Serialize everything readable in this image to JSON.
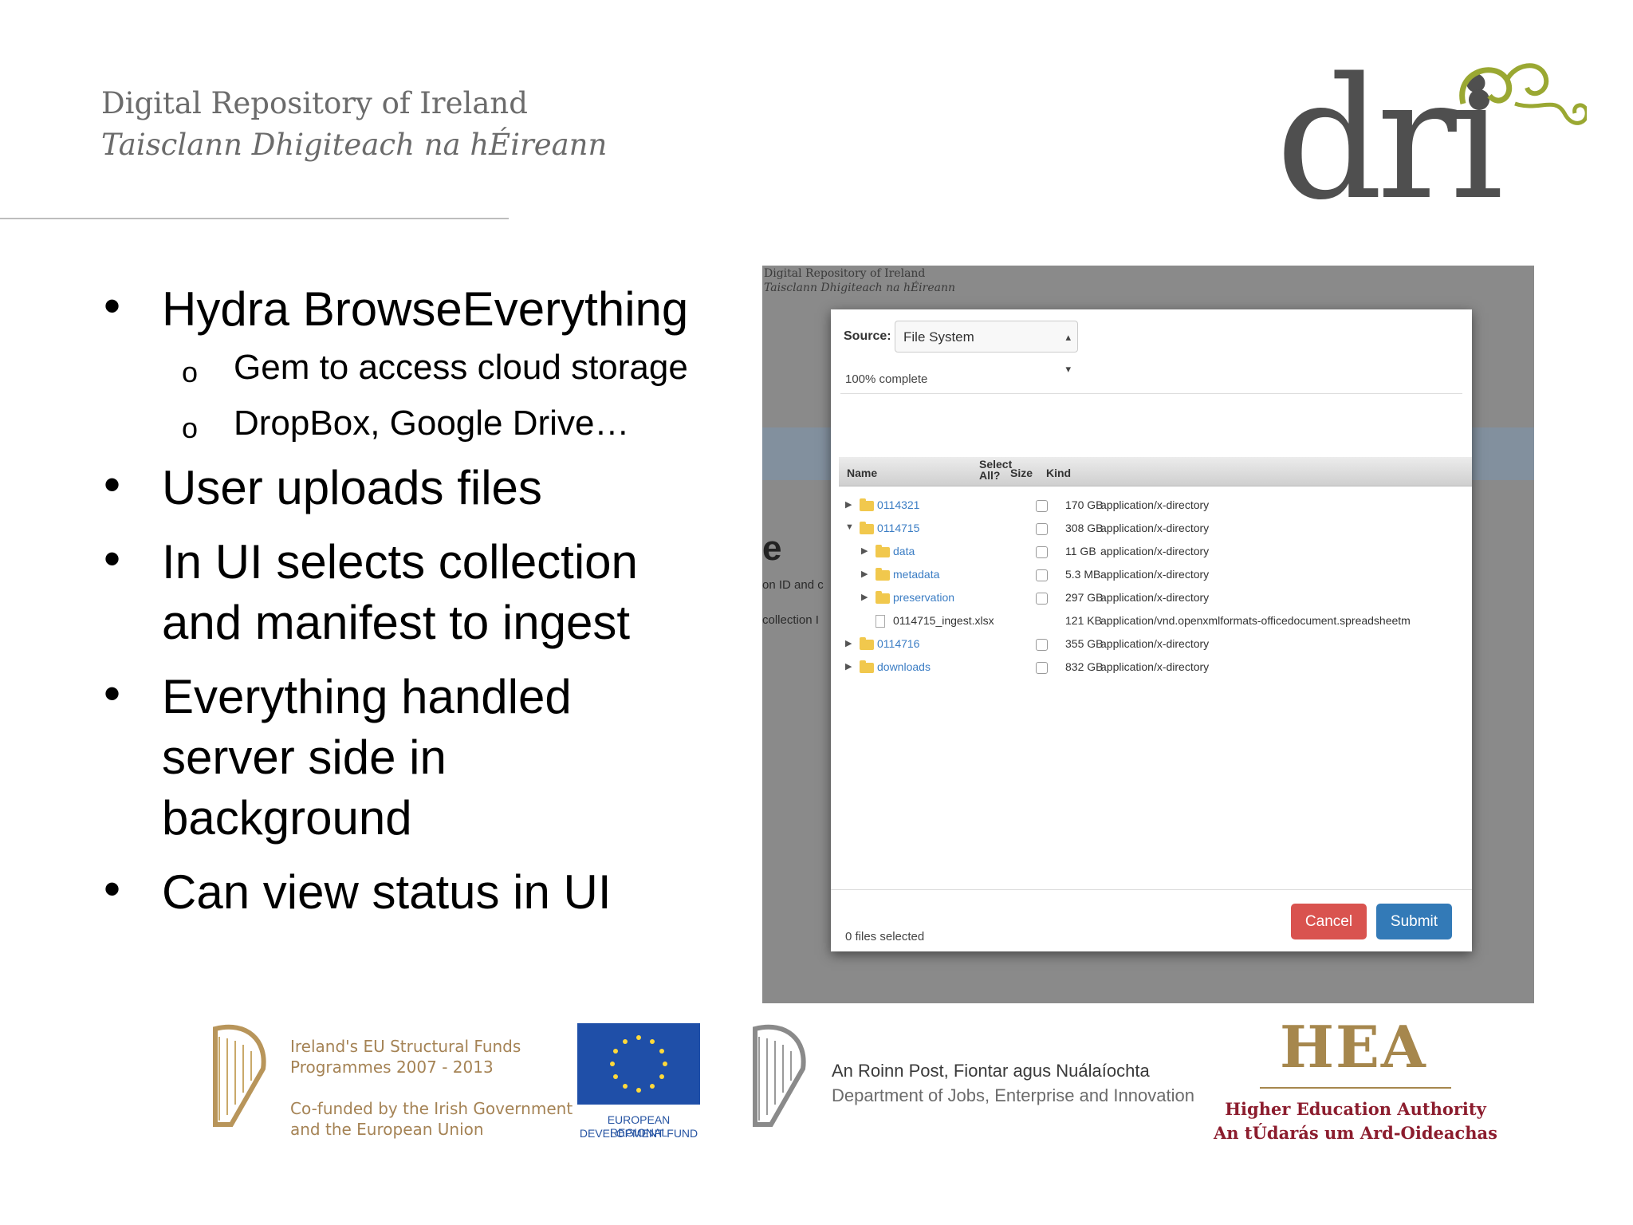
{
  "header": {
    "org_name_en": "Digital Repository of Ireland",
    "org_name_ga": "Taisclann Dhigiteach na hÉireann",
    "logo_text": "dri"
  },
  "bullets": [
    {
      "text": "Hydra BrowseEverything",
      "sub": [
        "Gem to access cloud storage",
        "DropBox, Google Drive…"
      ]
    },
    {
      "text": "User uploads files"
    },
    {
      "text": "In UI selects collection and manifest to ingest"
    },
    {
      "text": "Everything handled server side in background"
    },
    {
      "text": "Can view status in UI"
    }
  ],
  "screenshot": {
    "bg_org_en": "Digital Repository of Ireland",
    "bg_org_ga": "Taisclann Dhigiteach na hÉireann",
    "bg_heading_fragment": "e",
    "bg_text_1": "on ID and c",
    "bg_text_2": "collection I",
    "source_label": "Source:",
    "source_value": "File System",
    "progress_text": "100% complete",
    "columns": {
      "name": "Name",
      "select_all": "Select All?",
      "size": "Size",
      "kind": "Kind"
    },
    "rows": [
      {
        "name": "0114321",
        "size": "170 GB",
        "kind": "application/x-directory",
        "depth": 0,
        "toggle": "▶",
        "type": "folder",
        "checkbox": true
      },
      {
        "name": "0114715",
        "size": "308 GB",
        "kind": "application/x-directory",
        "depth": 0,
        "toggle": "▼",
        "type": "folder",
        "checkbox": true
      },
      {
        "name": "data",
        "size": "11 GB",
        "kind": "application/x-directory",
        "depth": 1,
        "toggle": "▶",
        "type": "folder",
        "checkbox": true
      },
      {
        "name": "metadata",
        "size": "5.3 MB",
        "kind": "application/x-directory",
        "depth": 1,
        "toggle": "▶",
        "type": "folder",
        "checkbox": true
      },
      {
        "name": "preservation",
        "size": "297 GB",
        "kind": "application/x-directory",
        "depth": 1,
        "toggle": "▶",
        "type": "folder",
        "checkbox": true
      },
      {
        "name": "0114715_ingest.xlsx",
        "size": "121 KB",
        "kind": "application/vnd.openxmlformats-officedocument.spreadsheetm",
        "depth": 1,
        "toggle": "",
        "type": "file",
        "checkbox": false
      },
      {
        "name": "0114716",
        "size": "355 GB",
        "kind": "application/x-directory",
        "depth": 0,
        "toggle": "▶",
        "type": "folder",
        "checkbox": true
      },
      {
        "name": "downloads",
        "size": "832 GB",
        "kind": "application/x-directory",
        "depth": 0,
        "toggle": "▶",
        "type": "folder",
        "checkbox": true
      }
    ],
    "files_selected": "0 files selected",
    "cancel_label": "Cancel",
    "submit_label": "Submit"
  },
  "footer": {
    "structural_funds_line1": "Ireland's EU Structural Funds",
    "structural_funds_line2": "Programmes 2007 - 2013",
    "structural_funds_line3": "Co-funded by the Irish Government",
    "structural_funds_line4": "and the European Union",
    "eu_line1": "EUROPEAN REGIONAL",
    "eu_line2": "DEVELOPMENT FUND",
    "dept_ga": "An Roinn Post, Fiontar agus Nuálaíochta",
    "dept_en": "Department of Jobs, Enterprise and Innovation",
    "hea_mark": "HEA",
    "hea_en": "Higher Education Authority",
    "hea_ga": "An tÚdarás um Ard-Oideachas"
  },
  "colors": {
    "cancel": "#d9534f",
    "submit": "#337ab7",
    "hea_red": "#8c1d2e",
    "hea_gold": "#a6874d",
    "dri_green": "#9aa832"
  }
}
